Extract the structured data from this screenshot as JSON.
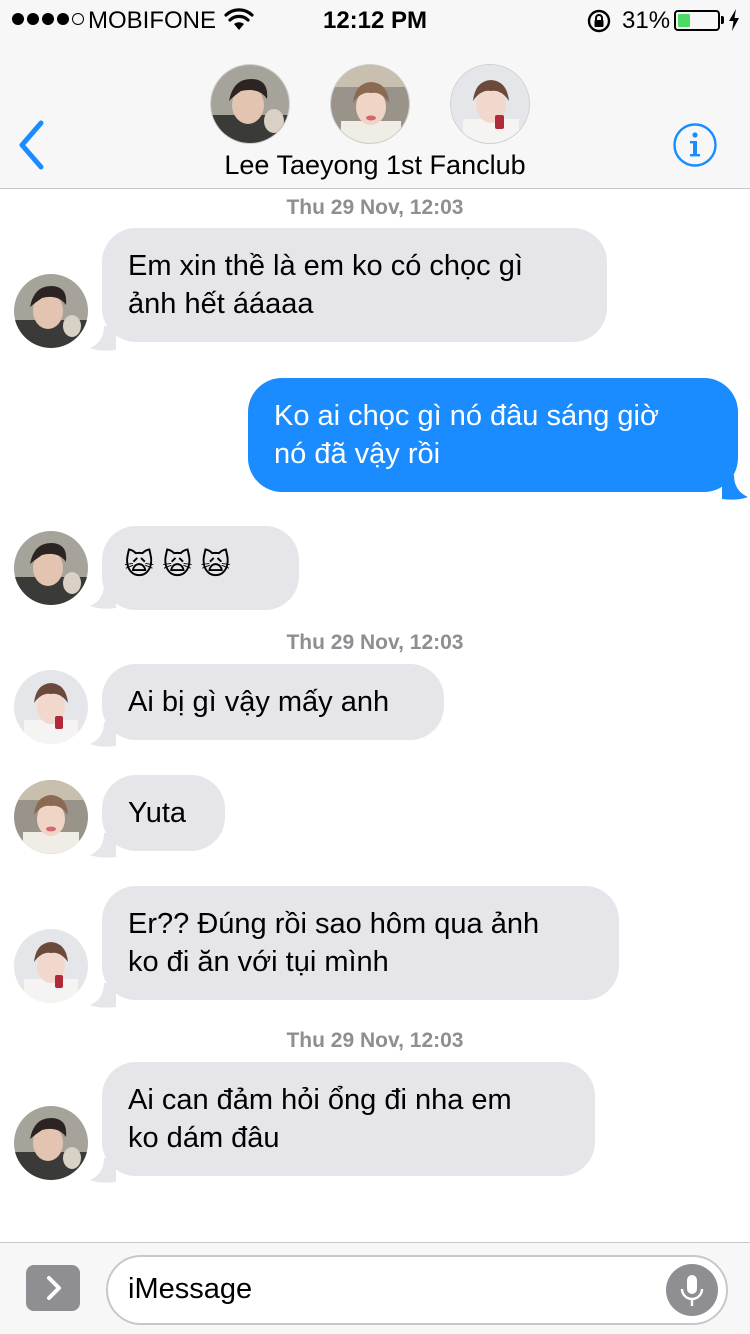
{
  "status_bar": {
    "carrier": "MOBIFONE",
    "time": "12:12 PM",
    "battery_percent": "31%",
    "battery_level": 0.31,
    "signal_bars_filled": 4,
    "signal_bars_total": 5
  },
  "header": {
    "title": "Lee Taeyong 1st Fanclub",
    "back_icon": "chevron-left-icon",
    "info_icon": "info-circle-icon",
    "accent_color": "#1a8cff"
  },
  "messages": {
    "ts1": "Thu 29 Nov, 12:03",
    "m1": {
      "line1": "Em xin thề là em ko có chọc gì",
      "line2": "ảnh hết ááaaa"
    },
    "m2": {
      "line1": "Ko ai chọc gì nó đâu sáng giờ",
      "line2": "nó đã vậy rồi"
    },
    "m3": {
      "emoji": [
        "🙀",
        "🙀",
        "🙀"
      ]
    },
    "ts2": "Thu 29 Nov, 12:03",
    "m4": {
      "line1": "Ai bị gì vậy mấy anh"
    },
    "m5": {
      "line1": "Yuta"
    },
    "m6": {
      "line1": "Er?? Đúng rồi sao hôm qua ảnh",
      "line2": "ko đi ăn với tụi mình"
    },
    "ts3": "Thu 29 Nov, 12:03",
    "m7": {
      "line1": "Ai can đảm hỏi ổng đi nha em",
      "line2": "ko dám đâu"
    }
  },
  "input_bar": {
    "placeholder": "iMessage",
    "expand_icon": "chevron-right-icon",
    "mic_icon": "microphone-icon"
  },
  "colors": {
    "incoming_bubble": "#e5e5ea",
    "outgoing_bubble": "#1a8cff",
    "timestamp": "#8e8e93",
    "battery": "#4cd964"
  }
}
